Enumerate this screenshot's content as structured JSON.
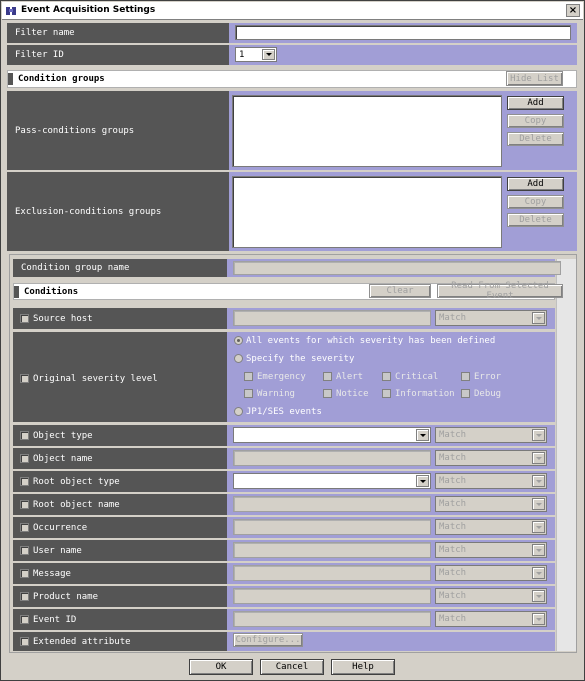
{
  "window": {
    "title": "Event Acquisition Settings",
    "close_glyph": "×"
  },
  "filter": {
    "name_label": "Filter name",
    "name_value": "",
    "id_label": "Filter ID",
    "id_value": "1"
  },
  "condition_groups": {
    "header": "Condition groups",
    "hide_list": "Hide List",
    "pass_label": "Pass-conditions groups",
    "exclusion_label": "Exclusion-conditions groups",
    "add": "Add",
    "copy": "Copy",
    "delete": "Delete"
  },
  "group_name_label": "Condition group name",
  "conditions": {
    "header": "Conditions",
    "clear": "Clear",
    "read_from_selected": "Read From Selected Event",
    "match": "Match",
    "configure": "Configure...",
    "rows": {
      "source_host": "Source host",
      "original_severity": "Original severity level",
      "object_type": "Object type",
      "object_name": "Object name",
      "root_object_type": "Root object type",
      "root_object_name": "Root object name",
      "occurrence": "Occurrence",
      "user_name": "User name",
      "message": "Message",
      "product_name": "Product name",
      "event_id": "Event ID",
      "extended_attribute": "Extended attribute"
    },
    "severity": {
      "all_events": "All events for which severity has been defined",
      "specify": "Specify the severity",
      "jp1_events": "JP1/SES events",
      "levels": [
        "Emergency",
        "Alert",
        "Critical",
        "Error",
        "Warning",
        "Notice",
        "Information",
        "Debug"
      ]
    }
  },
  "footer": {
    "ok": "OK",
    "cancel": "Cancel",
    "help": "Help"
  }
}
